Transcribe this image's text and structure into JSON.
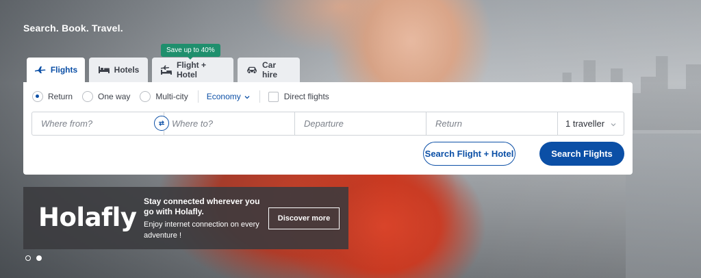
{
  "hero": {
    "tagline": "Search. Book. Travel."
  },
  "tabs": [
    {
      "label": "Flights",
      "icon": "plane-icon",
      "active": true
    },
    {
      "label": "Hotels",
      "icon": "bed-icon",
      "active": false
    },
    {
      "label": "Flight + Hotel",
      "icon": "plane-bed-icon",
      "active": false
    },
    {
      "label": "Car hire",
      "icon": "car-icon",
      "active": false
    }
  ],
  "promo": {
    "badge": "Save up to 40%"
  },
  "search": {
    "trip_types": [
      {
        "label": "Return",
        "selected": true
      },
      {
        "label": "One way",
        "selected": false
      },
      {
        "label": "Multi-city",
        "selected": false
      }
    ],
    "cabin": "Economy",
    "direct_flights_label": "Direct flights",
    "direct_flights_checked": false,
    "from_placeholder": "Where from?",
    "to_placeholder": "Where to?",
    "departure_placeholder": "Departure",
    "return_placeholder": "Return",
    "travellers": "1 traveller",
    "search_flight_hotel_label": "Search Flight + Hotel",
    "search_flights_label": "Search Flights"
  },
  "ad": {
    "logo": "Holafly",
    "headline": "Stay connected wherever you go with Holafly.",
    "body": "Enjoy internet connection on every adventure !",
    "cta": "Discover more"
  },
  "carousel": {
    "slides": 2,
    "active_index": 1
  },
  "colors": {
    "brand_blue": "#0b4fa6",
    "promo_green": "#1f8f6d"
  }
}
